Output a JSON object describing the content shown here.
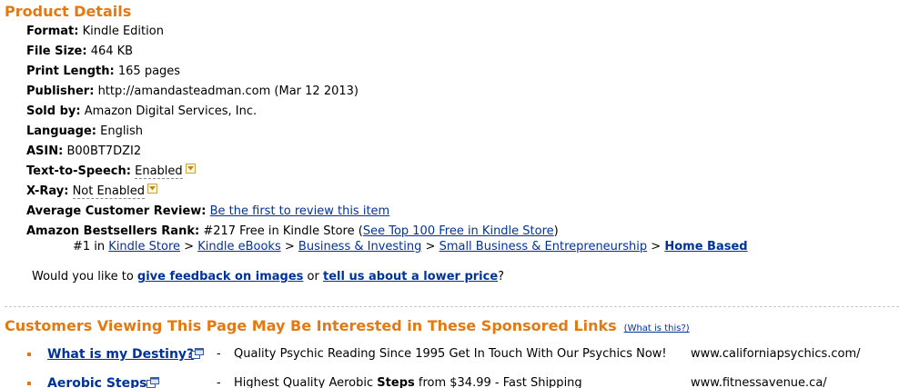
{
  "product_details": {
    "heading": "Product Details",
    "format": {
      "label": "Format:",
      "value": "Kindle Edition"
    },
    "file_size": {
      "label": "File Size:",
      "value": "464 KB"
    },
    "print_length": {
      "label": "Print Length:",
      "value": "165 pages"
    },
    "publisher": {
      "label": "Publisher:",
      "value": "http://amandasteadman.com (Mar 12 2013)"
    },
    "sold_by": {
      "label": "Sold by:",
      "value": "Amazon Digital Services, Inc."
    },
    "language": {
      "label": "Language:",
      "value": "English"
    },
    "asin": {
      "label": "ASIN:",
      "value": "B00BT7DZI2"
    },
    "tts": {
      "label": "Text-to-Speech:",
      "value": "Enabled"
    },
    "xray": {
      "label": "X-Ray:",
      "value": "Not Enabled"
    },
    "review": {
      "label": "Average Customer Review:",
      "link": "Be the first to review this item"
    },
    "rank": {
      "label": "Amazon Bestsellers Rank:",
      "value": "#217 Free in Kindle Store",
      "paren_open": "(",
      "top100_link": "See Top 100 Free in Kindle Store",
      "paren_close": ")",
      "sub_prefix": "#1 in",
      "sep": ">",
      "crumbs": [
        "Kindle Store",
        "Kindle eBooks",
        "Business & Investing",
        "Small Business & Entrepreneurship",
        "Home Based"
      ]
    }
  },
  "feedback": {
    "prefix": "Would you like to",
    "link1": "give feedback on images",
    "middle": "or",
    "link2": "tell us about a lower price",
    "suffix": "?"
  },
  "sponsored": {
    "heading": "Customers Viewing This Page May Be Interested in These Sponsored Links",
    "whatis": "(What is this?)",
    "ads": [
      {
        "title": "What is my Destiny?",
        "dash": "-",
        "desc": "Quality Psychic Reading Since 1995 Get In Touch With Our Psychics Now!",
        "url": "www.californiapsychics.com/"
      },
      {
        "title": "Aerobic Steps",
        "dash": "-",
        "desc_pre": "Highest Quality Aerobic",
        "desc_bold": "Steps",
        "desc_post": "from $34.99 - Fast Shipping",
        "url": "www.fitnessavenue.ca/"
      }
    ]
  },
  "colors": {
    "heading": "#E47911",
    "link": "#003399"
  }
}
